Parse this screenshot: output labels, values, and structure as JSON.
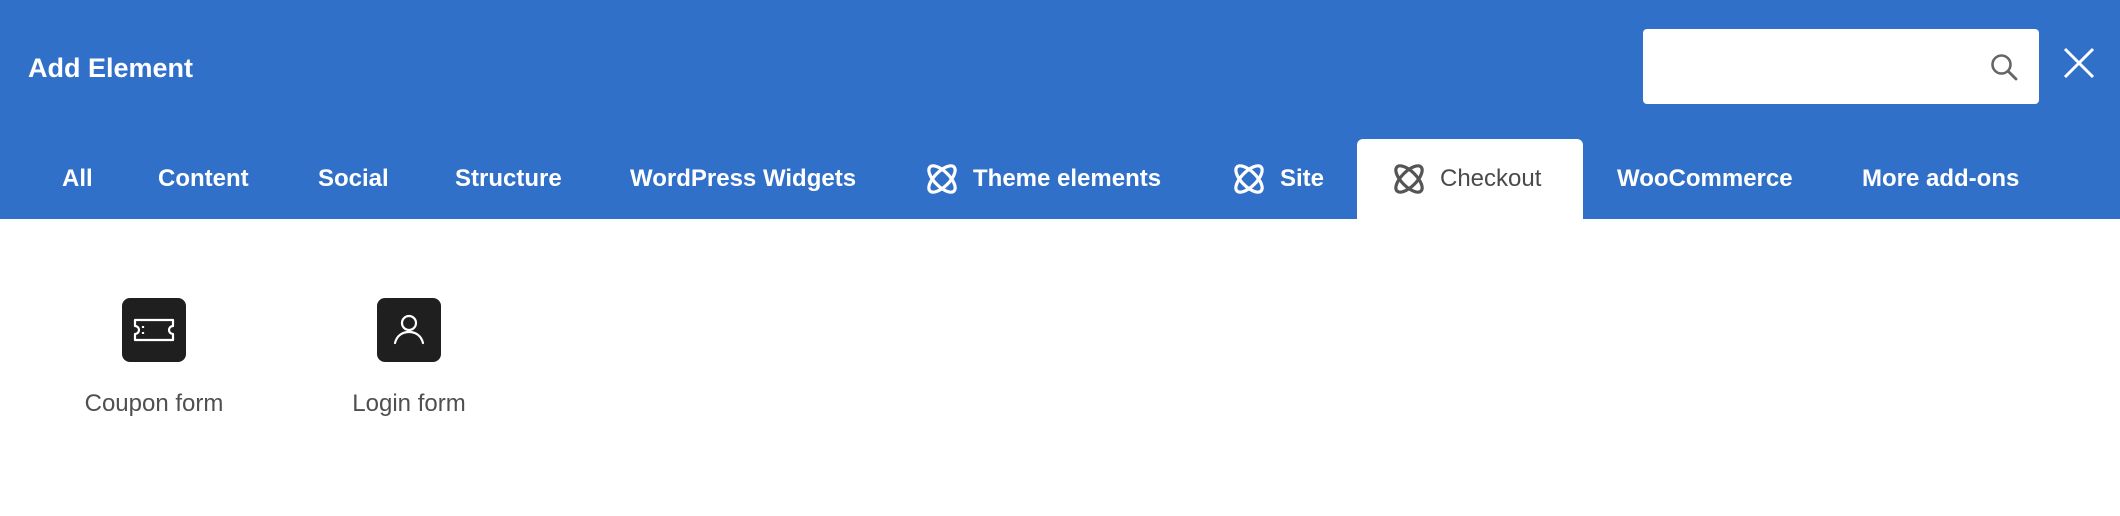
{
  "header": {
    "title": "Add Element",
    "background_color": "#3170c9",
    "search": {
      "value": "",
      "placeholder": "",
      "icon": "search-icon"
    },
    "close_icon": "close-icon"
  },
  "tabs": [
    {
      "label": "All",
      "icon": null,
      "active": false
    },
    {
      "label": "Content",
      "icon": null,
      "active": false
    },
    {
      "label": "Social",
      "icon": null,
      "active": false
    },
    {
      "label": "Structure",
      "icon": null,
      "active": false
    },
    {
      "label": "WordPress Widgets",
      "icon": null,
      "active": false
    },
    {
      "label": "Theme elements",
      "icon": "atom-icon",
      "active": false
    },
    {
      "label": "Site",
      "icon": "atom-icon",
      "active": false
    },
    {
      "label": "Checkout",
      "icon": "atom-icon",
      "active": true
    },
    {
      "label": "WooCommerce",
      "icon": null,
      "active": false
    },
    {
      "label": "More add-ons",
      "icon": null,
      "active": false
    }
  ],
  "elements": [
    {
      "label": "Coupon form",
      "icon": "ticket-icon"
    },
    {
      "label": "Login form",
      "icon": "user-icon"
    }
  ]
}
